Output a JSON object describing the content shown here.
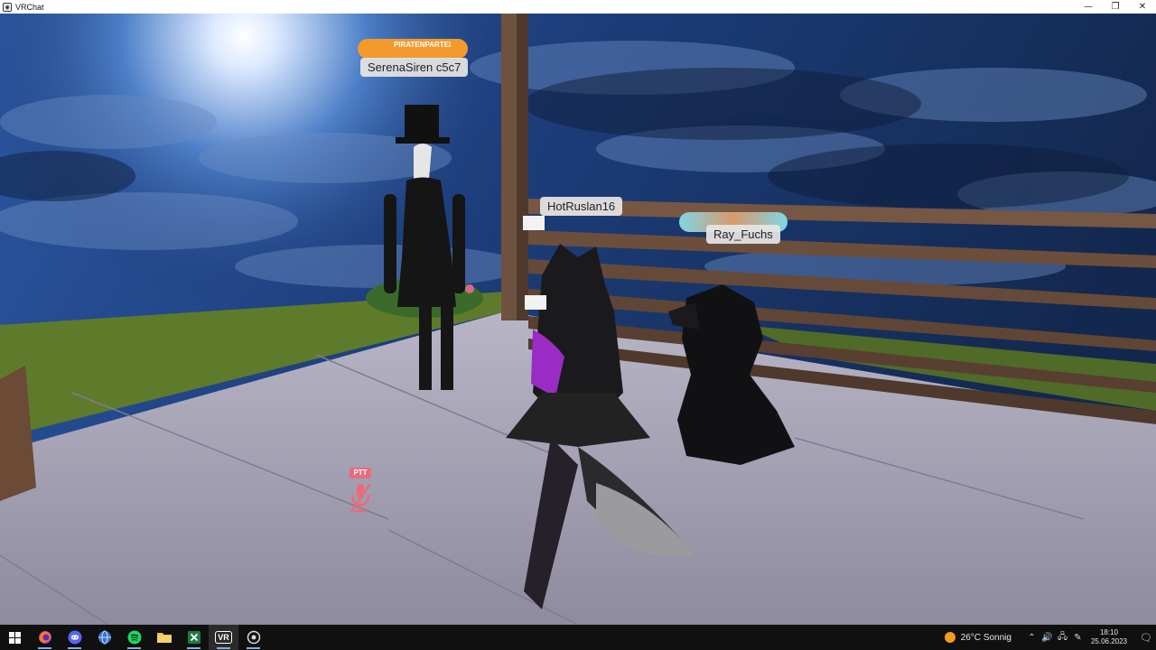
{
  "window": {
    "title": "VRChat",
    "app_icon": "vr-icon",
    "minimize_glyph": "—",
    "restore_glyph": "❐",
    "close_glyph": "✕"
  },
  "nameplates": [
    {
      "name": "SerenaSiren c5c7",
      "badge": "PIRATENPARTEI"
    },
    {
      "name": "HotRuslan16"
    },
    {
      "name": "Ray_Fuchs"
    }
  ],
  "ptt": {
    "label": "PTT",
    "icon": "muted-microphone-icon"
  },
  "taskbar": {
    "apps": [
      {
        "name": "start",
        "icon": "windows-start-icon"
      },
      {
        "name": "firefox",
        "icon": "firefox-icon"
      },
      {
        "name": "discord",
        "icon": "discord-icon"
      },
      {
        "name": "browser",
        "icon": "globe-icon"
      },
      {
        "name": "spotify",
        "icon": "spotify-icon"
      },
      {
        "name": "file-explorer",
        "icon": "folder-icon"
      },
      {
        "name": "excel",
        "icon": "excel-icon"
      },
      {
        "name": "vrchat",
        "icon": "vr-icon",
        "label": "VR"
      },
      {
        "name": "recorder",
        "icon": "record-icon"
      }
    ],
    "weather": {
      "temp": "26°C",
      "condition": "Sonnig"
    },
    "tray": {
      "chevron": "⌃",
      "speaker": "🔊",
      "network": "🖧",
      "pen": "✎"
    },
    "clock": {
      "time": "18:10",
      "date": "25.06.2023"
    },
    "notification_glyph": "🗨"
  },
  "colors": {
    "ptt_pink": "#e96b7e",
    "taskbar_bg": "#101010",
    "sky": "#1f3f7a",
    "grass": "#5c7a2c",
    "floor": "#a9a7b8",
    "fence": "#6a4d39"
  }
}
